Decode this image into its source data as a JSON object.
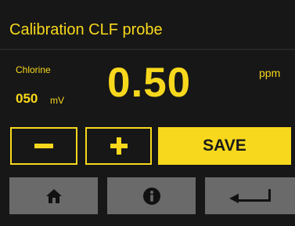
{
  "header": {
    "title": "Calibration CLF probe"
  },
  "measurement": {
    "parameter": "Chlorine",
    "mv_value": "050",
    "mv_unit": "mV",
    "value": "0.50",
    "unit": "ppm"
  },
  "controls": {
    "decrement_icon": "minus-icon",
    "increment_icon": "plus-icon",
    "save_label": "SAVE"
  },
  "navigation": {
    "home_icon": "home-icon",
    "info_icon": "info-icon",
    "back_icon": "back-arrow-icon"
  },
  "colors": {
    "background": "#171717",
    "accent": "#f8d81c",
    "nav_button": "#6a6a6a",
    "icon_dark": "#111111"
  }
}
